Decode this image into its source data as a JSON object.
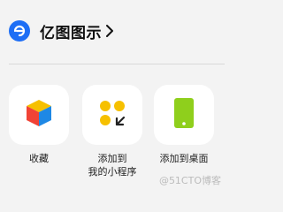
{
  "header": {
    "app_name": "亿图图示",
    "logo_icon": "edraw-logo-icon",
    "chevron_icon": "chevron-right-icon"
  },
  "actions": [
    {
      "label": "收藏",
      "icon": "cube-favorite-icon"
    },
    {
      "label_line1": "添加到",
      "label_line2": "我的小程序",
      "icon": "mini-program-icon"
    },
    {
      "label": "添加到桌面",
      "icon": "phone-desktop-icon"
    }
  ],
  "watermark": "@51CTO博客",
  "colors": {
    "background": "#f3f3f3",
    "tile": "#ffffff",
    "logo_blue": "#1d6ef5",
    "mini_program_yellow": "#f6c000",
    "desktop_green": "#8fcf1c"
  }
}
